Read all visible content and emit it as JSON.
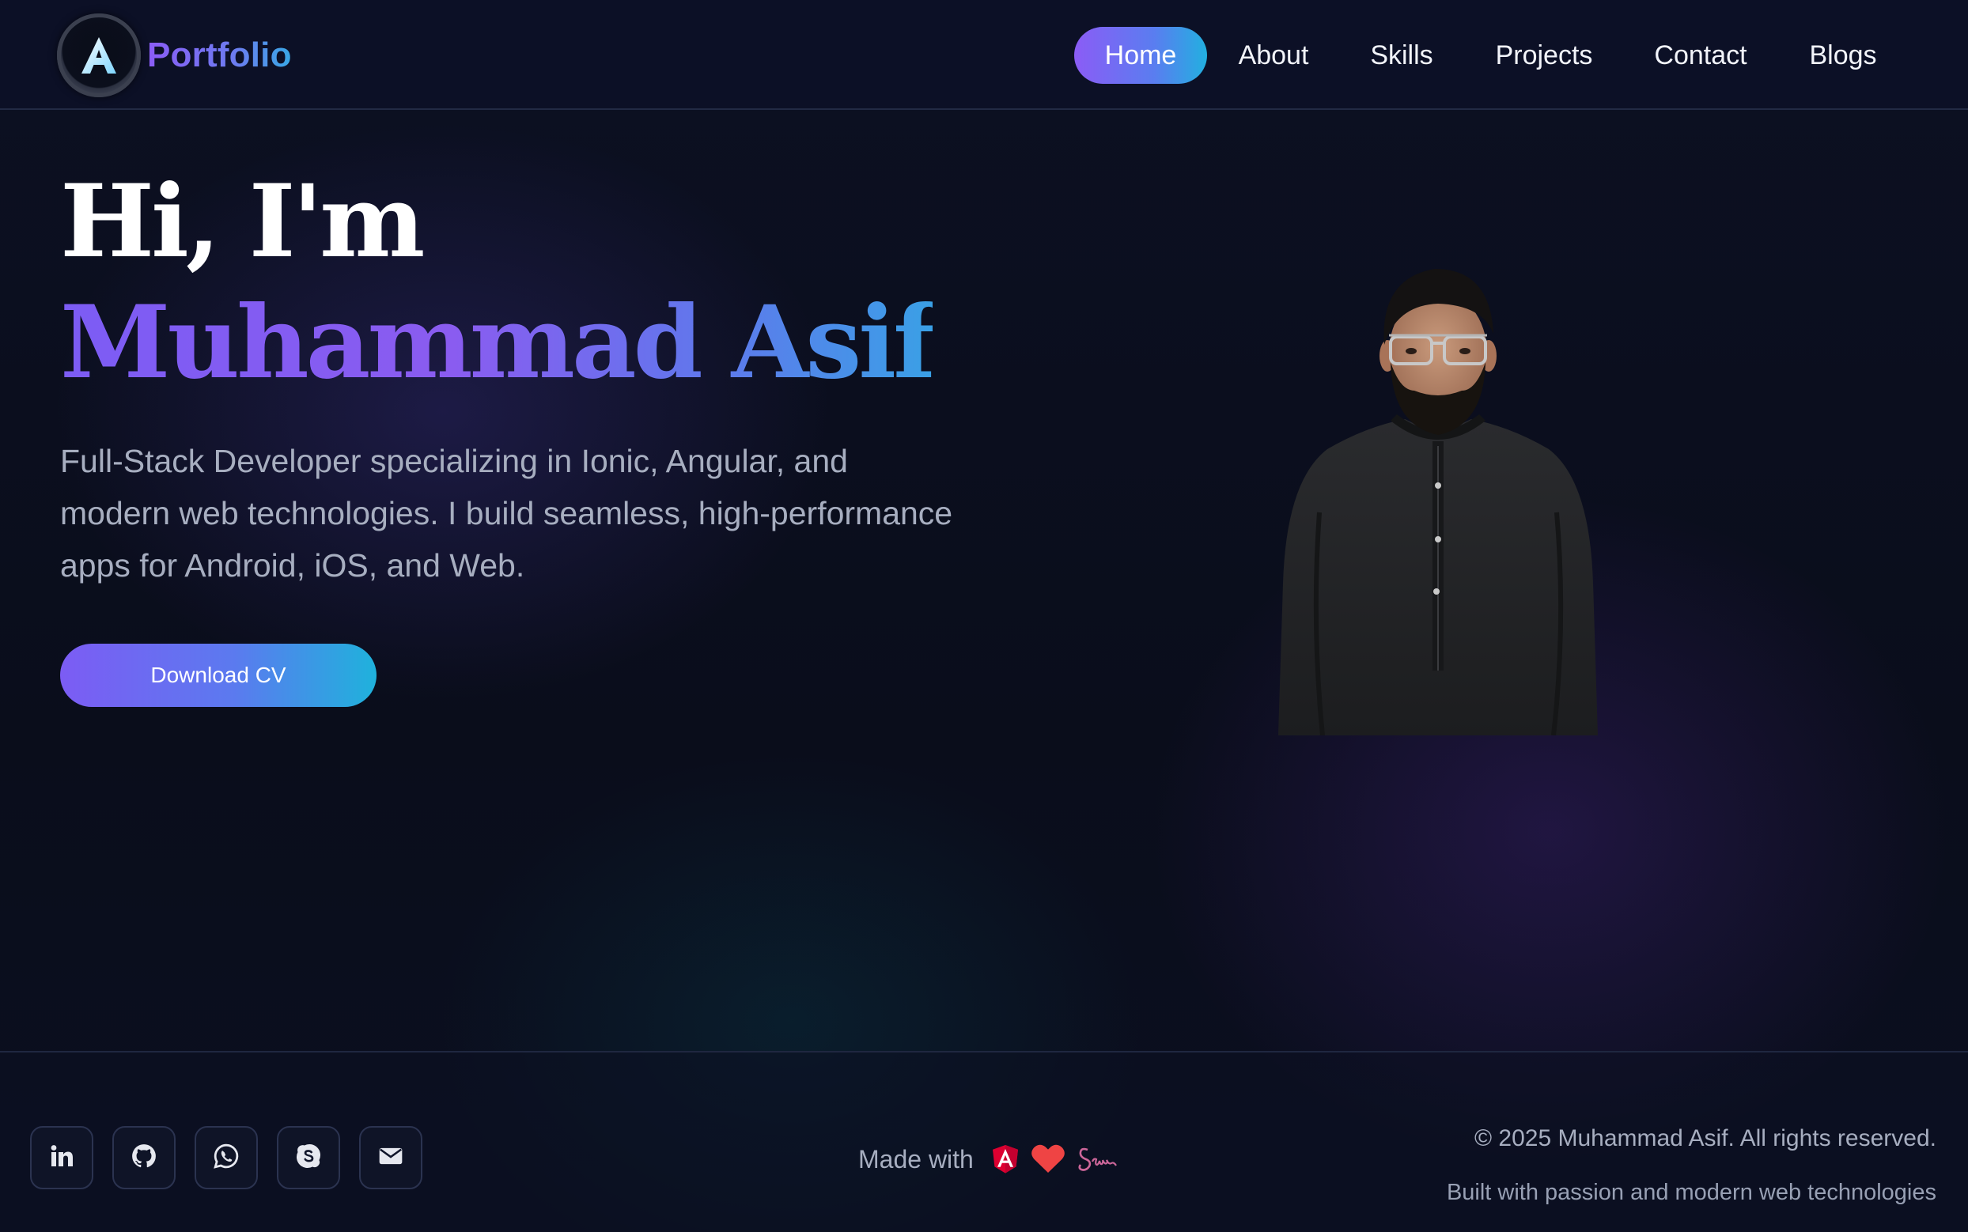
{
  "brand": {
    "name": "Portfolio",
    "logo_letter": "A"
  },
  "nav": {
    "items": [
      {
        "label": "Home",
        "active": true
      },
      {
        "label": "About",
        "active": false
      },
      {
        "label": "Skills",
        "active": false
      },
      {
        "label": "Projects",
        "active": false
      },
      {
        "label": "Contact",
        "active": false
      },
      {
        "label": "Blogs",
        "active": false
      }
    ]
  },
  "hero": {
    "greeting": "Hi, I'm",
    "name": "Muhammad Asif",
    "description": "Full-Stack Developer specializing in Ionic, Angular, and modern web technologies. I build seamless, high-performance apps for Android, iOS, and Web.",
    "cv_button": "Download CV"
  },
  "footer": {
    "social": [
      "linkedin-icon",
      "github-icon",
      "whatsapp-icon",
      "skype-icon",
      "email-icon"
    ],
    "made_with_label": "Made with",
    "made_with_icons": [
      "angular-icon",
      "heart-icon",
      "sass-icon"
    ],
    "copyright": "© 2025 Muhammad Asif. All rights reserved.",
    "built_with": "Built with passion and modern web technologies"
  },
  "colors": {
    "accent_start": "#8b5cf6",
    "accent_end": "#22b0e0",
    "background": "#0b0f1d",
    "heart": "#ef4444",
    "angular": "#dd0031",
    "sass": "#cc6699"
  }
}
